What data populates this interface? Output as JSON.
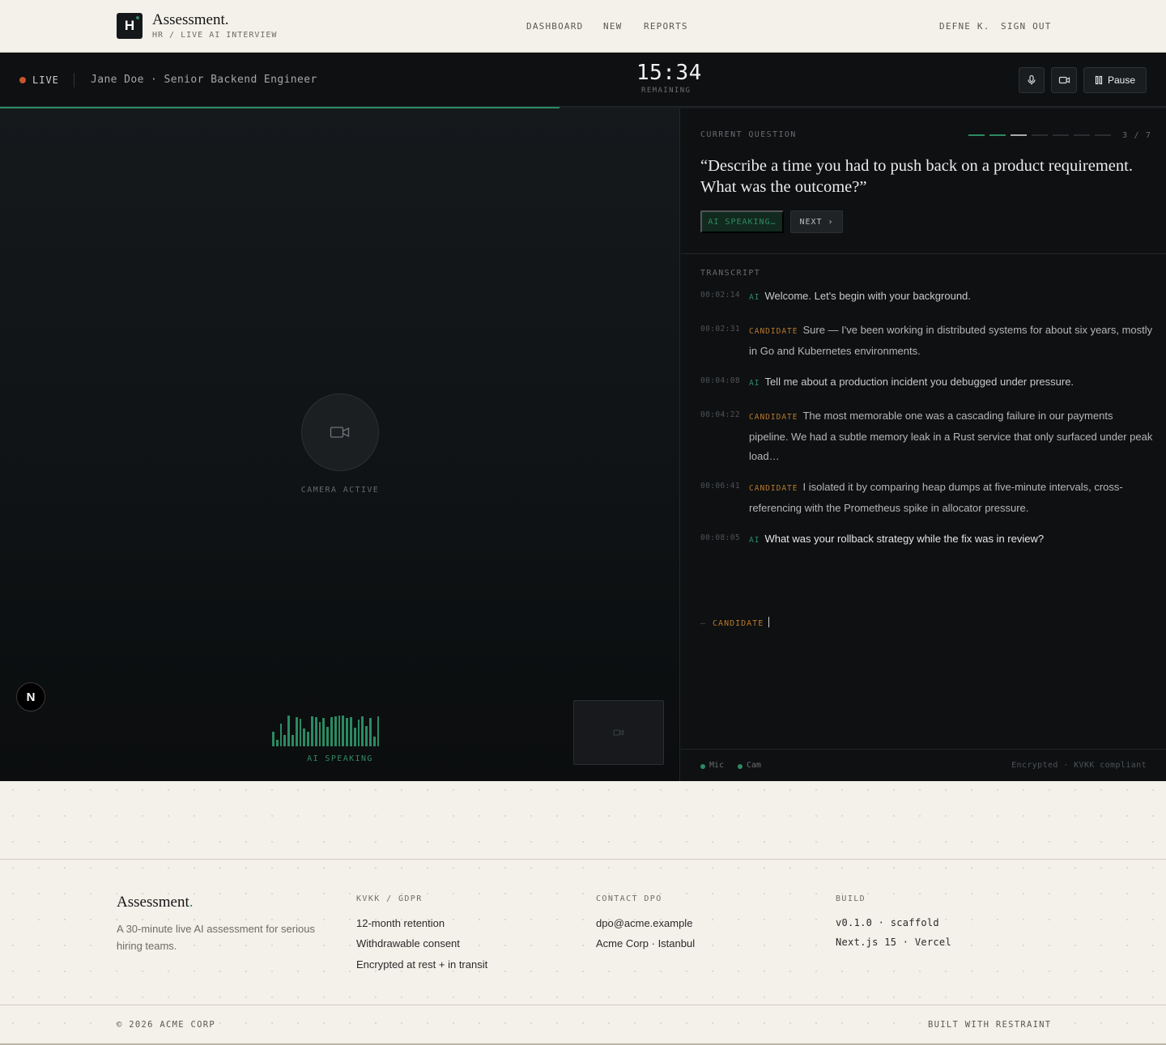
{
  "header": {
    "logo_letter": "H",
    "brand": "Assessment.",
    "subtitle": "HR / LIVE AI INTERVIEW",
    "nav": [
      "DASHBOARD",
      "NEW",
      "REPORTS"
    ],
    "user": "DEFNE K.",
    "sign_out": "SIGN OUT"
  },
  "session": {
    "status": "LIVE",
    "status_color": "#c8542c",
    "candidate": "Jane Doe · Senior Backend Engineer",
    "timer": "15:34",
    "timer_label": "REMAINING",
    "pause_label": "Pause",
    "progress": 0.48,
    "accent": "#2d8a62"
  },
  "video": {
    "camera_icon": "video-camera-icon",
    "camera_status": "CAMERA ACTIVE",
    "badge_letter": "N",
    "speaking_label": "AI SPEAKING",
    "waveform": [
      0.45,
      0.2,
      0.7,
      0.35,
      0.95,
      0.35,
      0.9,
      0.85,
      0.55,
      0.45,
      0.92,
      0.9,
      0.75,
      0.88,
      0.6,
      0.9,
      0.92,
      0.95,
      0.95,
      0.88,
      0.9,
      0.58,
      0.82,
      0.92,
      0.62,
      0.88,
      0.3,
      0.92
    ]
  },
  "question": {
    "label": "CURRENT QUESTION",
    "current": 3,
    "total": 7,
    "counter": "3 / 7",
    "text": "“Describe a time you had to push back on a product requirement. What was the outcome?”",
    "ai_button": "AI SPEAKING…",
    "next_button": "NEXT ›"
  },
  "transcript": {
    "label": "TRANSCRIPT",
    "entries": [
      {
        "time": "00:02:14",
        "role": "AI",
        "text": "Welcome. Let's begin with your background."
      },
      {
        "time": "00:02:31",
        "role": "CANDIDATE",
        "text": "Sure — I've been working in distributed systems for about six years, mostly in Go and Kubernetes environments."
      },
      {
        "time": "00:04:08",
        "role": "AI",
        "text": "Tell me about a production incident you debugged under pressure."
      },
      {
        "time": "00:04:22",
        "role": "CANDIDATE",
        "text": "The most memorable one was a cascading failure in our payments pipeline. We had a subtle memory leak in a Rust service that only surfaced under peak load…"
      },
      {
        "time": "00:06:41",
        "role": "CANDIDATE",
        "text": "I isolated it by comparing heap dumps at five-minute intervals, cross-referencing with the Prometheus spike in allocator pressure."
      },
      {
        "time": "00:08:05",
        "role": "AI",
        "text": "What was your rollback strategy while the fix was in review?"
      }
    ],
    "live_dash": "—",
    "live_role": "CANDIDATE"
  },
  "panel_footer": {
    "mic": "Mic",
    "cam": "Cam",
    "security": "Encrypted · KVKK compliant"
  },
  "footer": {
    "brand": "Assessment",
    "brand_dot": ".",
    "description": "A 30-minute live AI assessment for serious hiring teams.",
    "columns": [
      {
        "heading": "KVKK / GDPR",
        "items": [
          "12-month retention",
          "Withdrawable consent",
          "Encrypted at rest + in transit"
        ]
      },
      {
        "heading": "CONTACT DPO",
        "items": [
          "dpo@acme.example",
          "Acme Corp · Istanbul"
        ]
      },
      {
        "heading": "BUILD",
        "items": [
          "v0.1.0 · scaffold",
          "Next.js 15 · Vercel"
        ]
      }
    ],
    "copyright": "© 2026 ACME CORP",
    "built_with": "BUILT WITH RESTRAINT"
  }
}
